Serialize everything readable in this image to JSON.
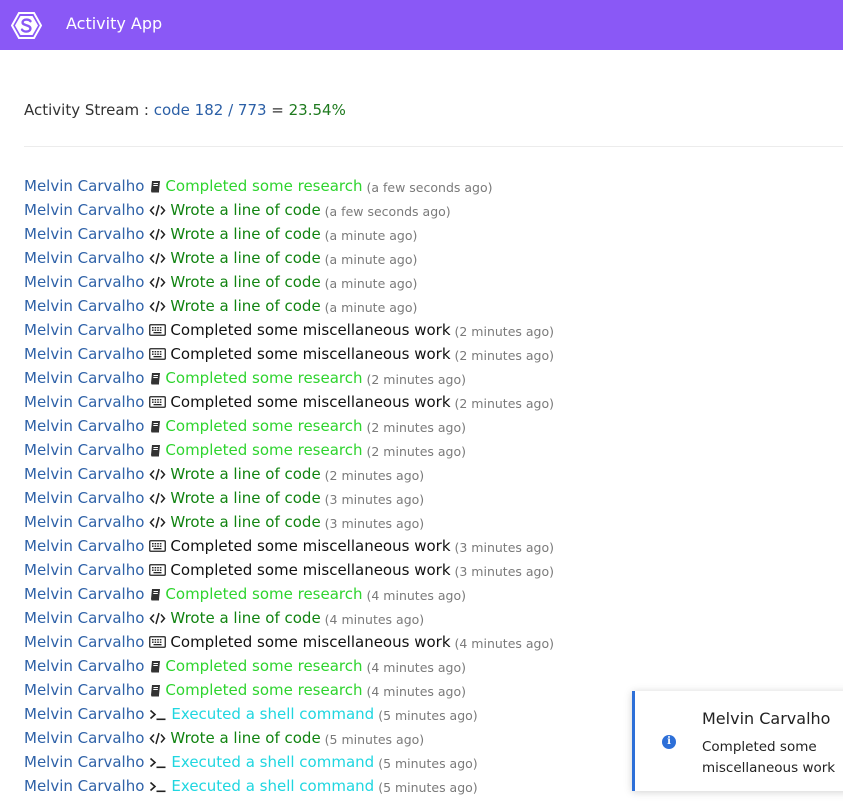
{
  "app": {
    "title": "Activity App",
    "brand_color": "#8a58f6"
  },
  "header": {
    "label": "Activity Stream : ",
    "code_text": "code 182 / 773",
    "equals": " = ",
    "percent": "23.54%"
  },
  "activity_types": {
    "research": {
      "icon": "book-icon",
      "color": "#2ed42e"
    },
    "code": {
      "icon": "code-icon",
      "color": "#118411"
    },
    "misc": {
      "icon": "keyboard-icon",
      "color": "#111111"
    },
    "shell": {
      "icon": "terminal-icon",
      "color": "#1fd6e0"
    }
  },
  "activities": [
    {
      "user": "Melvin Carvalho",
      "type": "research",
      "action": "Completed some research",
      "time": "(a few seconds ago)"
    },
    {
      "user": "Melvin Carvalho",
      "type": "code",
      "action": "Wrote a line of code",
      "time": "(a few seconds ago)"
    },
    {
      "user": "Melvin Carvalho",
      "type": "code",
      "action": "Wrote a line of code",
      "time": "(a minute ago)"
    },
    {
      "user": "Melvin Carvalho",
      "type": "code",
      "action": "Wrote a line of code",
      "time": "(a minute ago)"
    },
    {
      "user": "Melvin Carvalho",
      "type": "code",
      "action": "Wrote a line of code",
      "time": "(a minute ago)"
    },
    {
      "user": "Melvin Carvalho",
      "type": "code",
      "action": "Wrote a line of code",
      "time": "(a minute ago)"
    },
    {
      "user": "Melvin Carvalho",
      "type": "misc",
      "action": "Completed some miscellaneous work",
      "time": "(2 minutes ago)"
    },
    {
      "user": "Melvin Carvalho",
      "type": "misc",
      "action": "Completed some miscellaneous work",
      "time": "(2 minutes ago)"
    },
    {
      "user": "Melvin Carvalho",
      "type": "research",
      "action": "Completed some research",
      "time": "(2 minutes ago)"
    },
    {
      "user": "Melvin Carvalho",
      "type": "misc",
      "action": "Completed some miscellaneous work",
      "time": "(2 minutes ago)"
    },
    {
      "user": "Melvin Carvalho",
      "type": "research",
      "action": "Completed some research",
      "time": "(2 minutes ago)"
    },
    {
      "user": "Melvin Carvalho",
      "type": "research",
      "action": "Completed some research",
      "time": "(2 minutes ago)"
    },
    {
      "user": "Melvin Carvalho",
      "type": "code",
      "action": "Wrote a line of code",
      "time": "(2 minutes ago)"
    },
    {
      "user": "Melvin Carvalho",
      "type": "code",
      "action": "Wrote a line of code",
      "time": "(3 minutes ago)"
    },
    {
      "user": "Melvin Carvalho",
      "type": "code",
      "action": "Wrote a line of code",
      "time": "(3 minutes ago)"
    },
    {
      "user": "Melvin Carvalho",
      "type": "misc",
      "action": "Completed some miscellaneous work",
      "time": "(3 minutes ago)"
    },
    {
      "user": "Melvin Carvalho",
      "type": "misc",
      "action": "Completed some miscellaneous work",
      "time": "(3 minutes ago)"
    },
    {
      "user": "Melvin Carvalho",
      "type": "research",
      "action": "Completed some research",
      "time": "(4 minutes ago)"
    },
    {
      "user": "Melvin Carvalho",
      "type": "code",
      "action": "Wrote a line of code",
      "time": "(4 minutes ago)"
    },
    {
      "user": "Melvin Carvalho",
      "type": "misc",
      "action": "Completed some miscellaneous work",
      "time": "(4 minutes ago)"
    },
    {
      "user": "Melvin Carvalho",
      "type": "research",
      "action": "Completed some research",
      "time": "(4 minutes ago)"
    },
    {
      "user": "Melvin Carvalho",
      "type": "research",
      "action": "Completed some research",
      "time": "(4 minutes ago)"
    },
    {
      "user": "Melvin Carvalho",
      "type": "shell",
      "action": "Executed a shell command",
      "time": "(5 minutes ago)"
    },
    {
      "user": "Melvin Carvalho",
      "type": "code",
      "action": "Wrote a line of code",
      "time": "(5 minutes ago)"
    },
    {
      "user": "Melvin Carvalho",
      "type": "shell",
      "action": "Executed a shell command",
      "time": "(5 minutes ago)"
    },
    {
      "user": "Melvin Carvalho",
      "type": "shell",
      "action": "Executed a shell command",
      "time": "(5 minutes ago)"
    }
  ],
  "toast": {
    "icon": "info-icon",
    "title": "Melvin Carvalho",
    "message": "Completed some miscellaneous work",
    "accent_color": "#2d6fd8"
  }
}
